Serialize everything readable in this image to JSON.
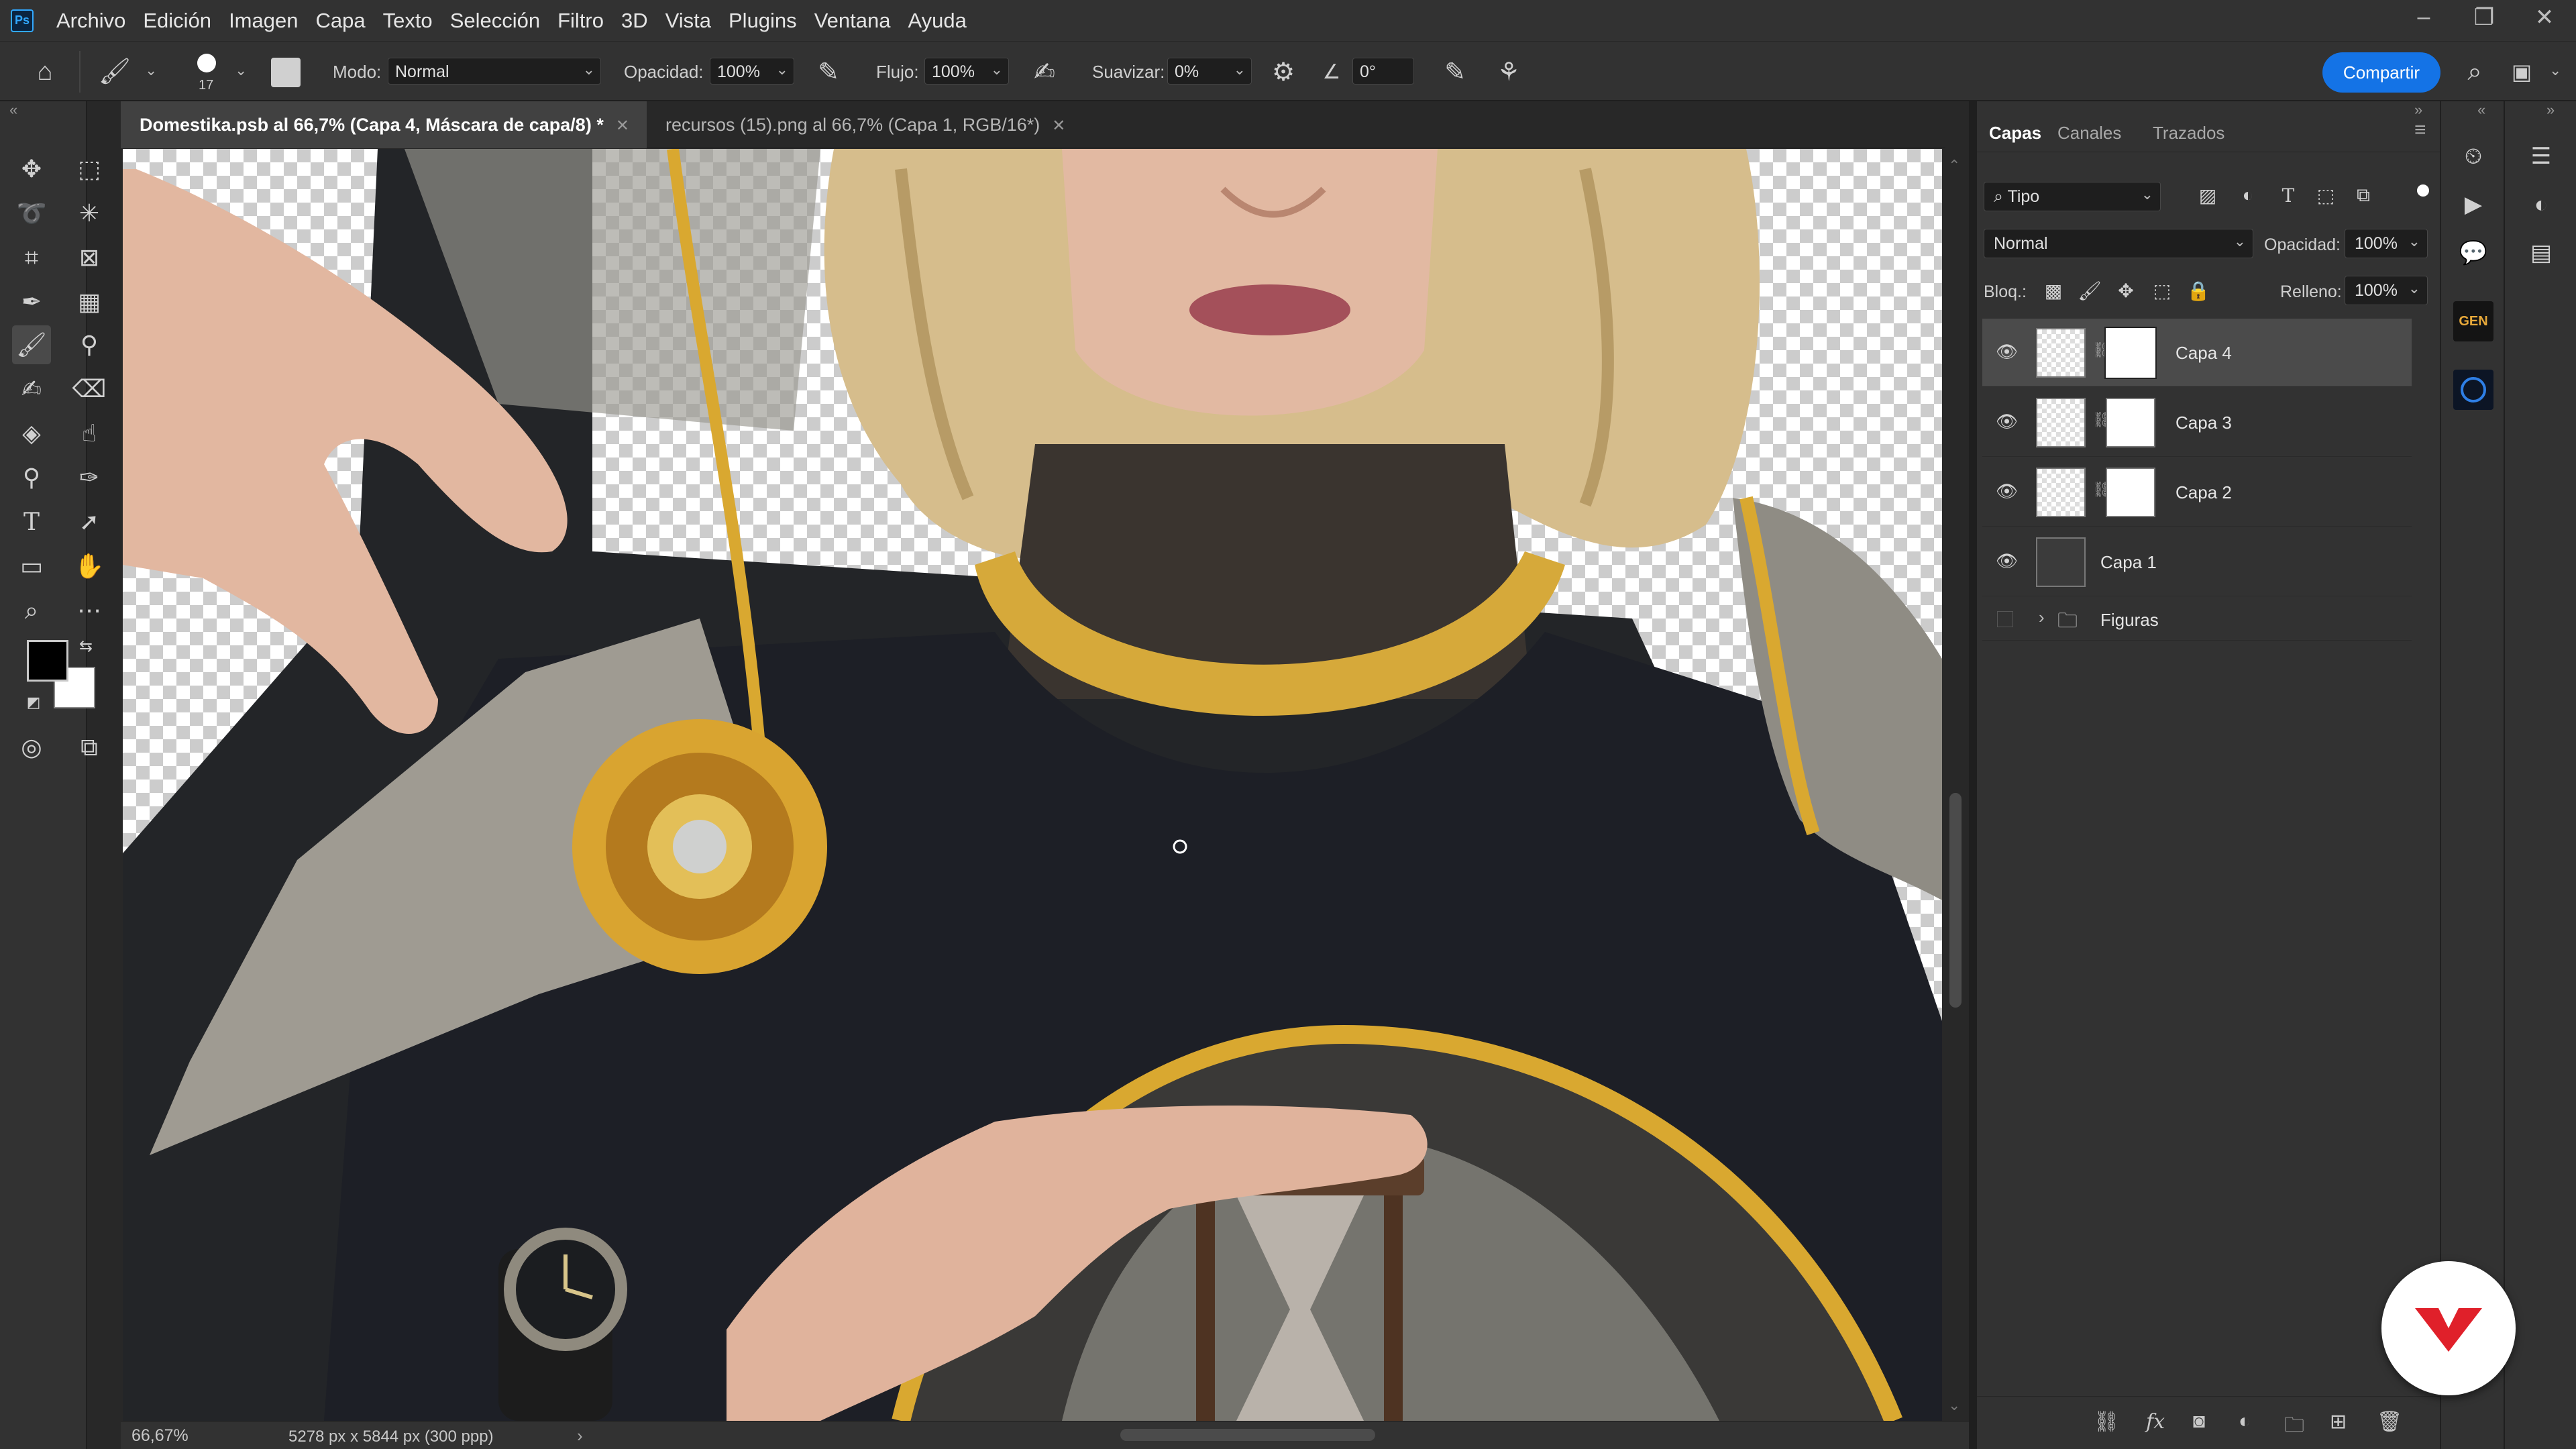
{
  "app": {
    "logo": "Ps",
    "accent": "#31a8ff"
  },
  "menubar": {
    "items": [
      "Archivo",
      "Edición",
      "Imagen",
      "Capa",
      "Texto",
      "Selección",
      "Filtro",
      "3D",
      "Vista",
      "Plugins",
      "Ventana",
      "Ayuda"
    ]
  },
  "options": {
    "brush_size": "17",
    "mode_label": "Modo:",
    "mode_value": "Normal",
    "opacity_label": "Opacidad:",
    "opacity_value": "100%",
    "flow_label": "Flujo:",
    "flow_value": "100%",
    "smoothing_label": "Suavizar:",
    "smoothing_value": "0%",
    "angle_value": "0°",
    "share_label": "Compartir"
  },
  "tabs": [
    {
      "label": "Domestika.psb al 66,7% (Capa 4, Máscara de capa/8) *",
      "active": true
    },
    {
      "label": "recursos (15).png al 66,7% (Capa 1, RGB/16*)",
      "active": false
    }
  ],
  "status": {
    "zoom": "66,67%",
    "doc_info": "5278 px x 5844 px (300 ppp)"
  },
  "layers_panel": {
    "tabs": [
      "Capas",
      "Canales",
      "Trazados"
    ],
    "filter_value": "Tipo",
    "blend_mode": "Normal",
    "opacity_label": "Opacidad:",
    "opacity_value": "100%",
    "lock_label": "Bloq.:",
    "fill_label": "Relleno:",
    "fill_value": "100%",
    "layers": [
      {
        "name": "Capa 4",
        "has_mask": true,
        "selected": true
      },
      {
        "name": "Capa 3",
        "has_mask": true,
        "selected": false
      },
      {
        "name": "Capa 2",
        "has_mask": true,
        "selected": false
      },
      {
        "name": "Capa 1",
        "has_mask": false,
        "selected": false
      },
      {
        "name": "Figuras",
        "group": true,
        "selected": false
      }
    ]
  },
  "right_panel": {
    "gen_badge": "GEN"
  },
  "colors": {
    "foreground": "#000000",
    "background": "#ffffff",
    "share_button": "#1473e6",
    "brand": "#e0202a"
  }
}
